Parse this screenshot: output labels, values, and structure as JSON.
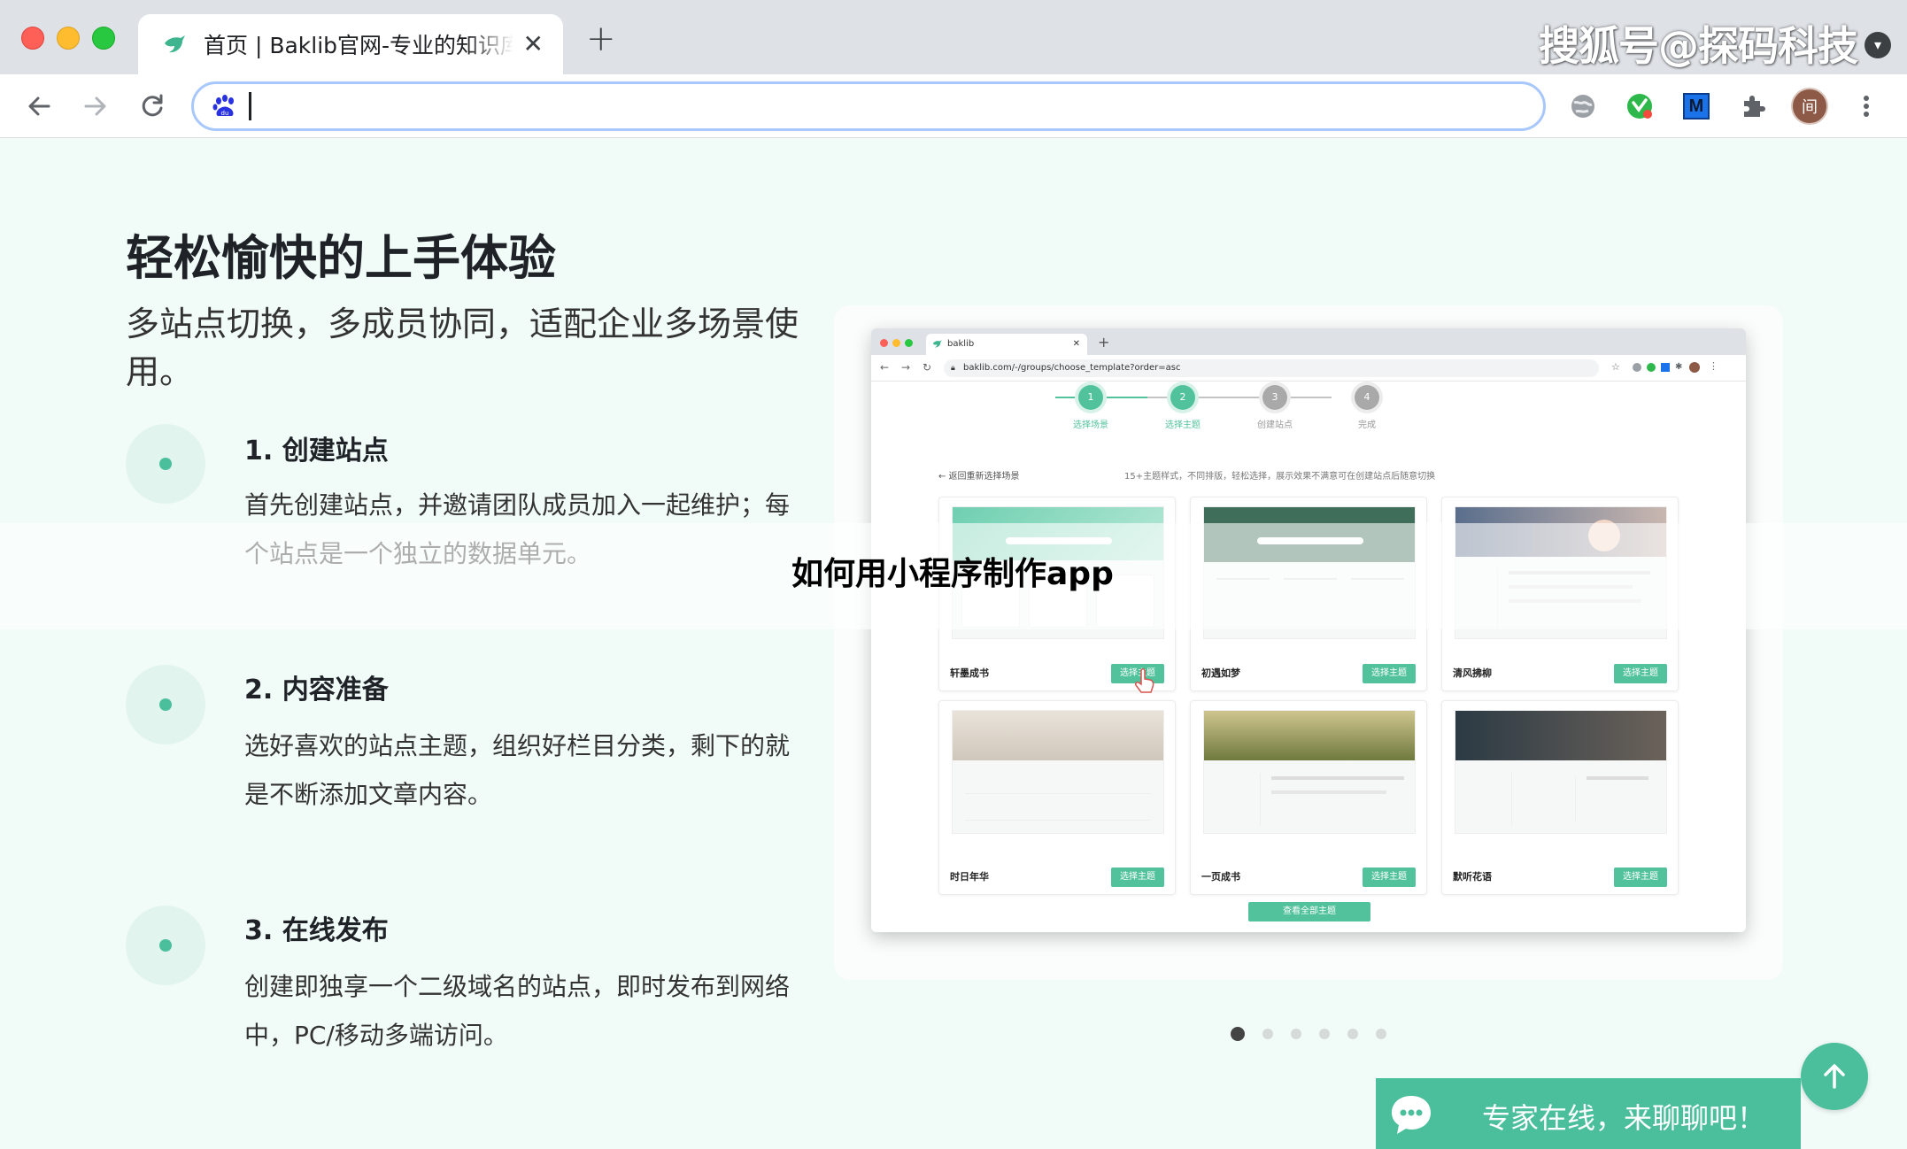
{
  "browser": {
    "tab_title": "首页 | Baklib官网-专业的知识库产品",
    "tab_close": "✕",
    "new_tab": "+",
    "watermark": "搜狐号@探码科技",
    "address_value": "",
    "profile_initial": "间",
    "ext_m_label": "M"
  },
  "section": {
    "title": "轻松愉快的上手体验",
    "subtitle": "多站点切换，多成员协同，适配企业多场景使用。"
  },
  "features": [
    {
      "title": "1. 创建站点",
      "desc": "首先创建站点，并邀请团队成员加入一起维护；每个站点是一个独立的数据单元。"
    },
    {
      "title": "2. 内容准备",
      "desc": "选好喜欢的站点主题，组织好栏目分类，剩下的就是不断添加文章内容。"
    },
    {
      "title": "3. 在线发布",
      "desc": "创建即独享一个二级域名的站点，即时发布到网络中，PC/移动多端访问。"
    }
  ],
  "overlay_title": "如何用小程序制作app",
  "preview": {
    "tab_label": "baklib",
    "url": "baklib.com/-/groups/choose_template?order=asc",
    "steps": [
      {
        "num": "1",
        "label": "选择场景",
        "state": "done"
      },
      {
        "num": "2",
        "label": "选择主题",
        "state": "current"
      },
      {
        "num": "3",
        "label": "创建站点",
        "state": "todo"
      },
      {
        "num": "4",
        "label": "完成",
        "state": "todo"
      }
    ],
    "back_link": "← 返回重新选择场景",
    "hint": "15+主题样式，不同排版，轻松选择，展示效果不满意可在创建站点后随意切换",
    "themes": [
      {
        "name": "轩墨成书",
        "button": "选择主题"
      },
      {
        "name": "初遇如梦",
        "button": "选择主题"
      },
      {
        "name": "清风拂柳",
        "button": "选择主题"
      },
      {
        "name": "时日年华",
        "button": "选择主题"
      },
      {
        "name": "一页成书",
        "button": "选择主题"
      },
      {
        "name": "默听花语",
        "button": "选择主题"
      }
    ],
    "view_all": "查看全部主题"
  },
  "carousel": {
    "count": 6,
    "active": 0
  },
  "chat": {
    "label": "专家在线，来聊聊吧！"
  },
  "colors": {
    "accent": "#4bbf9c",
    "page_bg": "#f1fbf8",
    "step_todo": "#c4c4c4"
  }
}
